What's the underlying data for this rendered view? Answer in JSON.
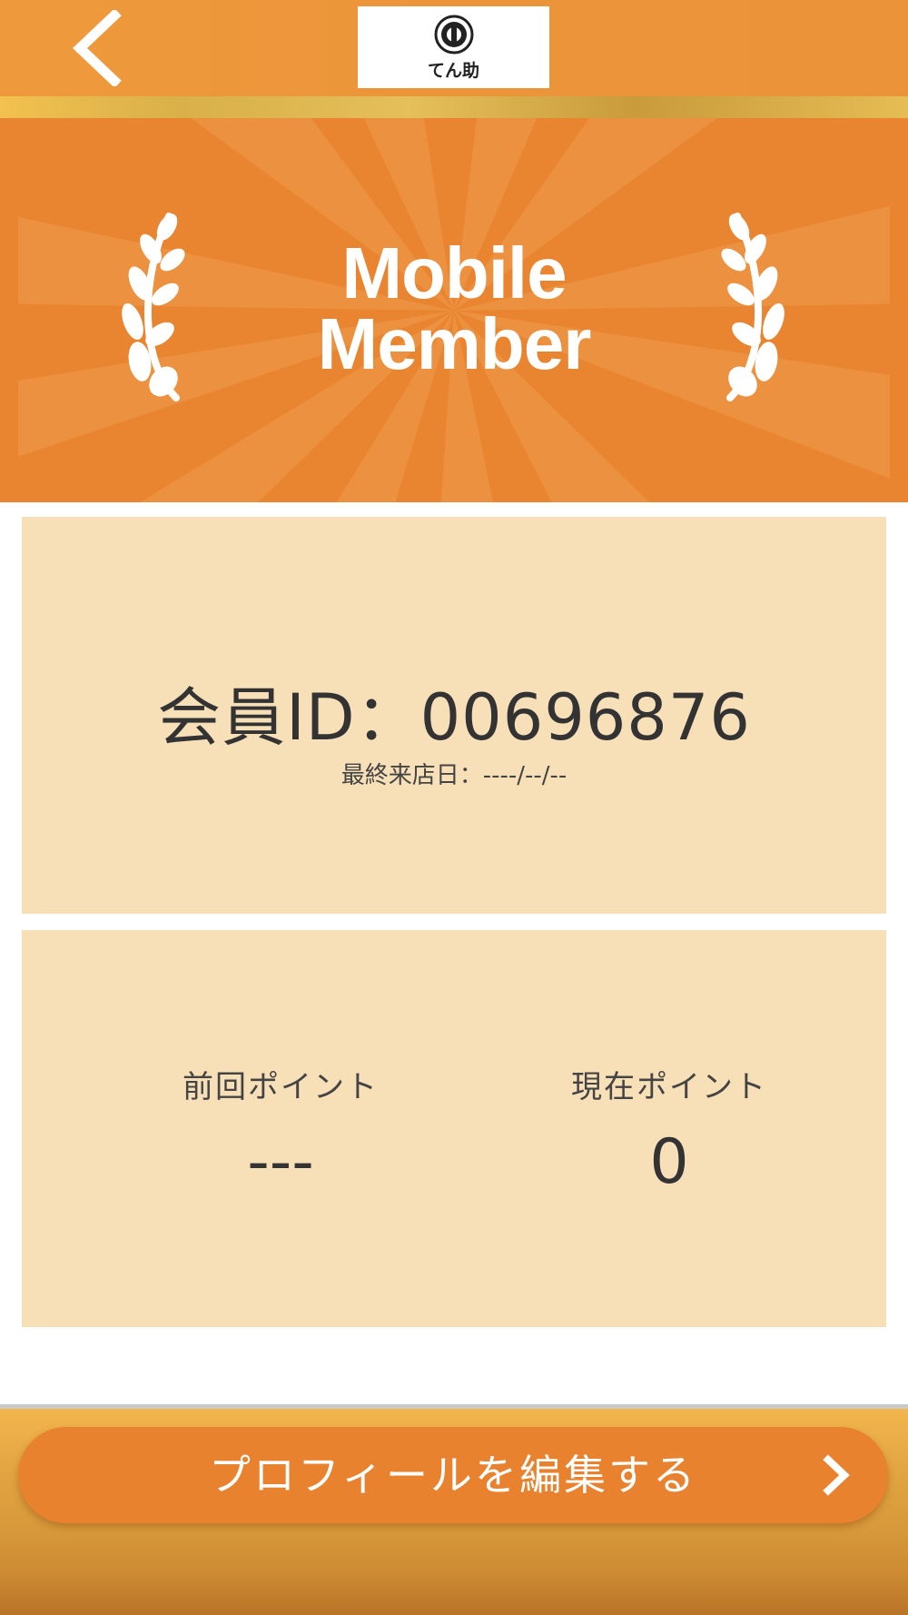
{
  "header": {
    "back_icon": "chevron-left-icon",
    "logo_text": "てん助"
  },
  "banner": {
    "title_line1": "Mobile",
    "title_line2": "Member"
  },
  "member": {
    "id_text": "会員ID：00696876",
    "last_visit_text": "最終来店日：----/--/--"
  },
  "points": {
    "previous_label": "前回ポイント",
    "previous_value": "---",
    "current_label": "現在ポイント",
    "current_value": "0"
  },
  "footer": {
    "edit_profile_label": "プロフィールを編集する",
    "chevron_icon": "chevron-right-icon"
  },
  "colors": {
    "header": "#ec943a",
    "banner": "#e98430",
    "card": "#f7e0b8",
    "button": "#e8822e"
  }
}
